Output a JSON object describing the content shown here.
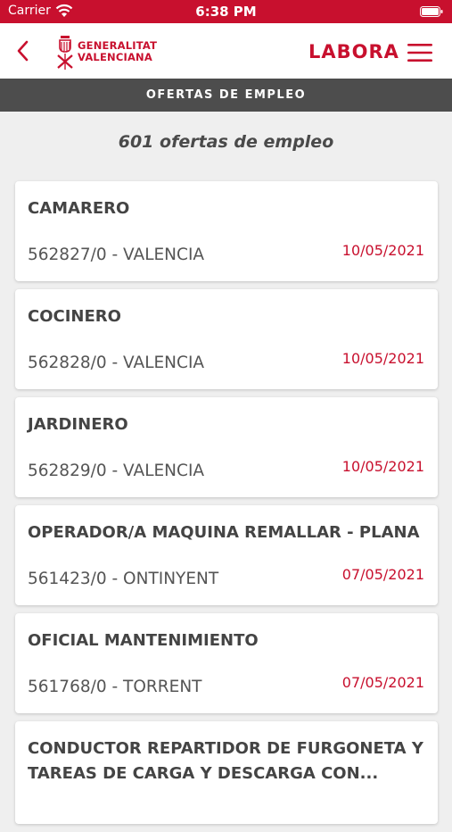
{
  "status_bar": {
    "carrier": "Carrier",
    "time": "6:38 PM"
  },
  "header": {
    "logo_line1": "GENERALITAT",
    "logo_line2": "VALENCIANA",
    "brand": "LABORA"
  },
  "section_title": "OFERTAS DE EMPLEO",
  "offer_count": "601 ofertas de empleo",
  "offers": [
    {
      "title": "CAMARERO",
      "ref": "562827/0 - VALENCIA",
      "date": "10/05/2021"
    },
    {
      "title": "COCINERO",
      "ref": "562828/0 - VALENCIA",
      "date": "10/05/2021"
    },
    {
      "title": "JARDINERO",
      "ref": "562829/0 - VALENCIA",
      "date": "10/05/2021"
    },
    {
      "title": "OPERADOR/A MAQUINA REMALLAR - PLANA",
      "ref": "561423/0 - ONTINYENT",
      "date": "07/05/2021"
    },
    {
      "title": "OFICIAL MANTENIMIENTO",
      "ref": "561768/0 - TORRENT",
      "date": "07/05/2021"
    },
    {
      "title": "CONDUCTOR REPARTIDOR DE FURGONETA Y TAREAS DE CARGA Y DESCARGA CON...",
      "ref": "",
      "date": ""
    }
  ],
  "colors": {
    "brand_red": "#c8102e",
    "section_bar": "#4d4d4d",
    "background": "#efefef"
  },
  "icons": {
    "back": "chevron-left-icon",
    "menu": "hamburger-menu-icon",
    "wifi": "wifi-icon",
    "battery": "battery-icon"
  }
}
